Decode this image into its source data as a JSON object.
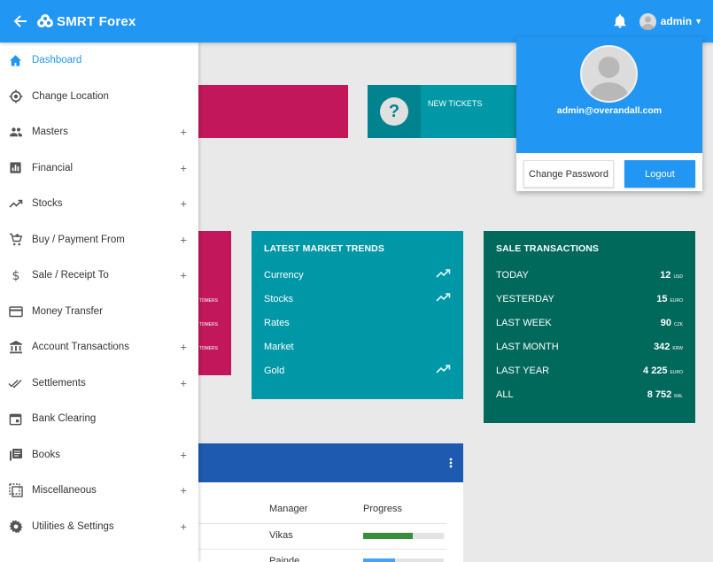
{
  "app": {
    "title": "SMRT Forex"
  },
  "header": {
    "user_label": "admin"
  },
  "sidebar": {
    "items": [
      {
        "label": "Dashboard",
        "icon": "home-icon",
        "active": true,
        "expandable": false
      },
      {
        "label": "Change Location",
        "icon": "location-icon",
        "expandable": false
      },
      {
        "label": "Masters",
        "icon": "people-icon",
        "expandable": true
      },
      {
        "label": "Financial",
        "icon": "bar-chart-icon",
        "expandable": true
      },
      {
        "label": "Stocks",
        "icon": "trending-up-icon",
        "expandable": true
      },
      {
        "label": "Buy / Payment From",
        "icon": "cart-icon",
        "expandable": true
      },
      {
        "label": "Sale / Receipt To",
        "icon": "dollar-icon",
        "expandable": true
      },
      {
        "label": "Money Transfer",
        "icon": "credit-card-icon",
        "expandable": false
      },
      {
        "label": "Account Transactions",
        "icon": "bank-icon",
        "expandable": true
      },
      {
        "label": "Settlements",
        "icon": "double-check-icon",
        "expandable": true
      },
      {
        "label": "Bank Clearing",
        "icon": "calendar-icon",
        "expandable": false
      },
      {
        "label": "Books",
        "icon": "books-icon",
        "expandable": true
      },
      {
        "label": "Miscellaneous",
        "icon": "misc-icon",
        "expandable": true
      },
      {
        "label": "Utilities & Settings",
        "icon": "gear-icon",
        "expandable": true
      }
    ],
    "expand_symbol": "+"
  },
  "tiles": {
    "new_tickets_label": "NEW TICKETS",
    "new_tickets_icon": "?",
    "partial_rows": [
      "TOMERS",
      "TOMERS",
      "TOMERS"
    ]
  },
  "trends": {
    "title": "LATEST MARKET TRENDS",
    "rows": [
      {
        "label": "Currency",
        "trend": true
      },
      {
        "label": "Stocks",
        "trend": true
      },
      {
        "label": "Rates",
        "trend": false
      },
      {
        "label": "Market",
        "trend": false
      },
      {
        "label": "Gold",
        "trend": true
      }
    ]
  },
  "sales": {
    "title": "SALE TRANSACTIONS",
    "rows": [
      {
        "label": "TODAY",
        "value": "12",
        "unit": "USD"
      },
      {
        "label": "YESTERDAY",
        "value": "15",
        "unit": "EURO"
      },
      {
        "label": "LAST WEEK",
        "value": "90",
        "unit": "CZK"
      },
      {
        "label": "LAST MONTH",
        "value": "342",
        "unit": "KRW"
      },
      {
        "label": "LAST YEAR",
        "value": "4 225",
        "unit": "EURO"
      },
      {
        "label": "ALL",
        "value": "8 752",
        "unit": "RAL"
      }
    ]
  },
  "table": {
    "headers": {
      "manager": "Manager",
      "progress": "Progress"
    },
    "rows": [
      {
        "manager": "Vikas",
        "progress": 0.62,
        "color": "#388e3c"
      },
      {
        "manager": "Painde",
        "progress": 0.4,
        "color": "#42a5f5"
      }
    ]
  },
  "profile": {
    "email": "admin@overandall.com",
    "change_password_label": "Change Password",
    "logout_label": "Logout"
  },
  "colors": {
    "primary": "#2196f3",
    "pink": "#c2185b",
    "teal": "#0097a7",
    "dark_teal": "#00695c",
    "table_header": "#1e5ab0"
  }
}
